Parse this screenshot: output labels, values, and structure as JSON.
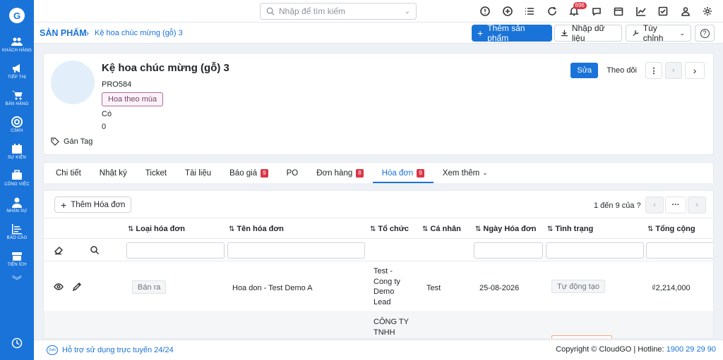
{
  "sidebar": {
    "items": [
      {
        "label": "KHÁCH HÀNG",
        "icon": "users-icon"
      },
      {
        "label": "TIẾP THỊ",
        "icon": "megaphone-icon"
      },
      {
        "label": "BÁN HÀNG",
        "icon": "cart-icon"
      },
      {
        "label": "CSKH",
        "icon": "support-icon"
      },
      {
        "label": "SỰ KIỆN",
        "icon": "calendar-icon"
      },
      {
        "label": "CÔNG VIỆC",
        "icon": "briefcase-icon"
      },
      {
        "label": "NHÂN SỰ",
        "icon": "person-icon"
      },
      {
        "label": "BÁO CÁO",
        "icon": "report-icon"
      },
      {
        "label": "TIỆN ÍCH",
        "icon": "box-icon"
      }
    ]
  },
  "header": {
    "search_placeholder": "Nhập để tìm kiếm",
    "notification_count": "696"
  },
  "breadcrumb": {
    "module": "SẢN PHẨM",
    "separator": "›",
    "record": "Kệ hoa chúc mừng (gỗ) 3"
  },
  "toolbar": {
    "add_product": "Thêm sản phẩm",
    "import": "Nhập dữ liệu",
    "customize": "Tùy chỉnh",
    "help": "?"
  },
  "product": {
    "title": "Kệ hoa chúc mừng (gỗ) 3",
    "code": "PRO584",
    "tag": "Hoa theo mùa",
    "flag": "Có",
    "qty": "0",
    "add_tag": "Gán Tag",
    "edit": "Sửa",
    "follow": "Theo dõi"
  },
  "tabs": [
    {
      "label": "Chi tiết",
      "count": ""
    },
    {
      "label": "Nhật ký",
      "count": ""
    },
    {
      "label": "Ticket",
      "count": ""
    },
    {
      "label": "Tài liệu",
      "count": ""
    },
    {
      "label": "Báo giá",
      "count": "9"
    },
    {
      "label": "PO",
      "count": ""
    },
    {
      "label": "Đơn hàng",
      "count": "8"
    },
    {
      "label": "Hóa đơn",
      "count": "9"
    },
    {
      "label": "Xem thêm",
      "count": ""
    }
  ],
  "invoices": {
    "add_button": "Thêm Hóa đơn",
    "pager": "1 đến 9 của ?",
    "columns": [
      "Loại hóa đơn",
      "Tên hóa đơn",
      "Tổ chức",
      "Cá nhân",
      "Ngày Hóa đơn",
      "Tình trạng",
      "Tổng cộng"
    ],
    "rows": [
      {
        "type": "Bán ra",
        "name": "Hoa don - Test Demo A",
        "org": "Test - Cong ty Demo Lead",
        "person": "Test",
        "date": "25-08-2026",
        "status": "Tự động tạo",
        "total": "₫2,214,000"
      },
      {
        "type": "",
        "name": "",
        "org": "CÔNG TY TNHH",
        "person": "",
        "date": "",
        "status": "",
        "total": ""
      }
    ]
  },
  "footer": {
    "zalo": "Zalo",
    "support": "Hỗ trợ sử dụng trực tuyến 24/24",
    "copyright": "Copyright © CloudGO | Hotline: ",
    "hotline": "1900 29 29 90"
  },
  "colors": {
    "brand": "#1a73d9",
    "badge": "#dc3545"
  }
}
